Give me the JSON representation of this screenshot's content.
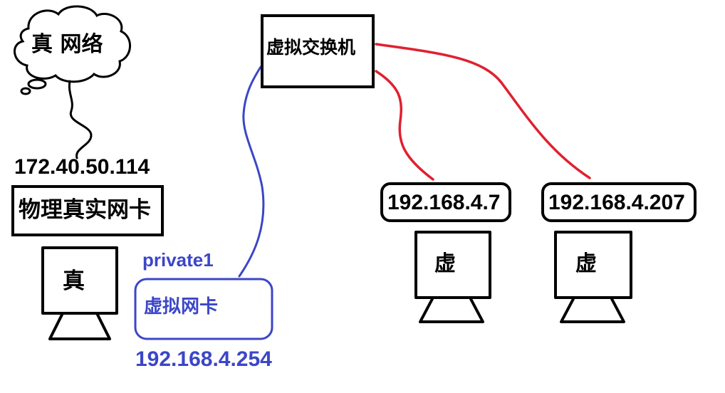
{
  "cloud_label": "真 网络",
  "real_ip": "172.40.50.114",
  "physical_nic_label": "物理真实网卡",
  "real_host_label": "真",
  "vnic_name": "private1",
  "vnic_label": "虚拟网卡",
  "vnic_ip": "192.168.4.254",
  "switch_label": "虚拟交换机",
  "vm1_ip": "192.168.4.7",
  "vm1_label": "虚",
  "vm2_ip": "192.168.4.207",
  "vm2_label": "虚",
  "colors": {
    "outline": "#000000",
    "blue_link": "#3b46c8",
    "red_link": "#e02030",
    "background": "#ffffff"
  }
}
